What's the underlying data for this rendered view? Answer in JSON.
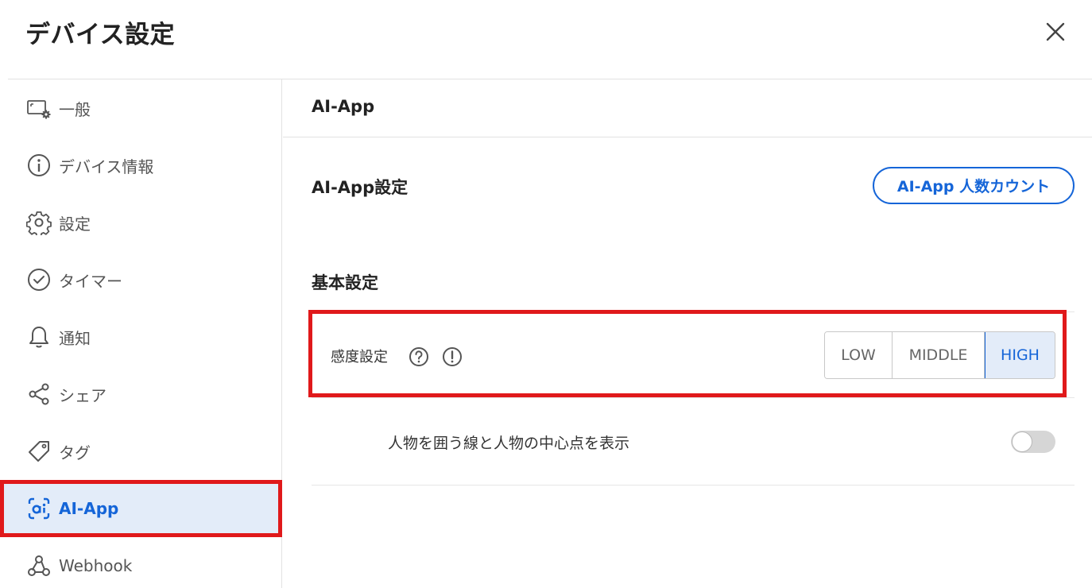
{
  "dialog": {
    "title": "デバイス設定",
    "close_icon": "close-icon"
  },
  "sidebar": {
    "items": [
      {
        "label": "一般",
        "icon": "device-gear-icon",
        "active": false
      },
      {
        "label": "デバイス情報",
        "icon": "info-icon",
        "active": false
      },
      {
        "label": "設定",
        "icon": "gear-icon",
        "active": false
      },
      {
        "label": "タイマー",
        "icon": "clock-icon",
        "active": false
      },
      {
        "label": "通知",
        "icon": "bell-icon",
        "active": false
      },
      {
        "label": "シェア",
        "icon": "share-icon",
        "active": false
      },
      {
        "label": "タグ",
        "icon": "tag-icon",
        "active": false
      },
      {
        "label": "AI-App",
        "icon": "ai-app-icon",
        "active": true
      },
      {
        "label": "Webhook",
        "icon": "webhook-icon",
        "active": false
      }
    ]
  },
  "main": {
    "header": "AI-App",
    "section_title": "AI-App設定",
    "count_button_label": "AI-App 人数カウント",
    "subsection_title": "基本設定",
    "sensitivity": {
      "label": "感度設定",
      "help_icon": "question-circle-icon",
      "warning_icon": "exclamation-circle-icon",
      "options": [
        "LOW",
        "MIDDLE",
        "HIGH"
      ],
      "selected": "HIGH"
    },
    "bounding_toggle": {
      "label": "人物を囲う線と人物の中心点を表示",
      "enabled": false
    }
  },
  "colors": {
    "accent": "#1565d8",
    "highlight": "#e0191b",
    "active_bg": "#e3ecf9"
  }
}
